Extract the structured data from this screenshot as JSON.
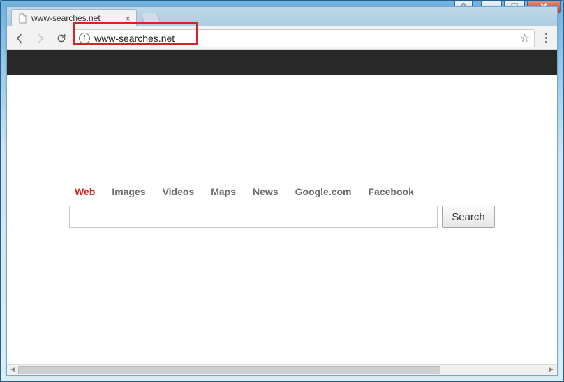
{
  "window": {
    "user_icon": "◈",
    "minimize": "—",
    "maximize": "❐",
    "close": "✕"
  },
  "browser": {
    "tab": {
      "title": "www-searches.net",
      "close": "×"
    },
    "back": "←",
    "forward": "→",
    "reload": "⟳",
    "site_info": "i",
    "url": "www-searches.net",
    "star": "☆"
  },
  "page": {
    "nav": {
      "web": "Web",
      "images": "Images",
      "videos": "Videos",
      "maps": "Maps",
      "news": "News",
      "google": "Google.com",
      "facebook": "Facebook"
    },
    "search_value": "",
    "search_button": "Search"
  }
}
